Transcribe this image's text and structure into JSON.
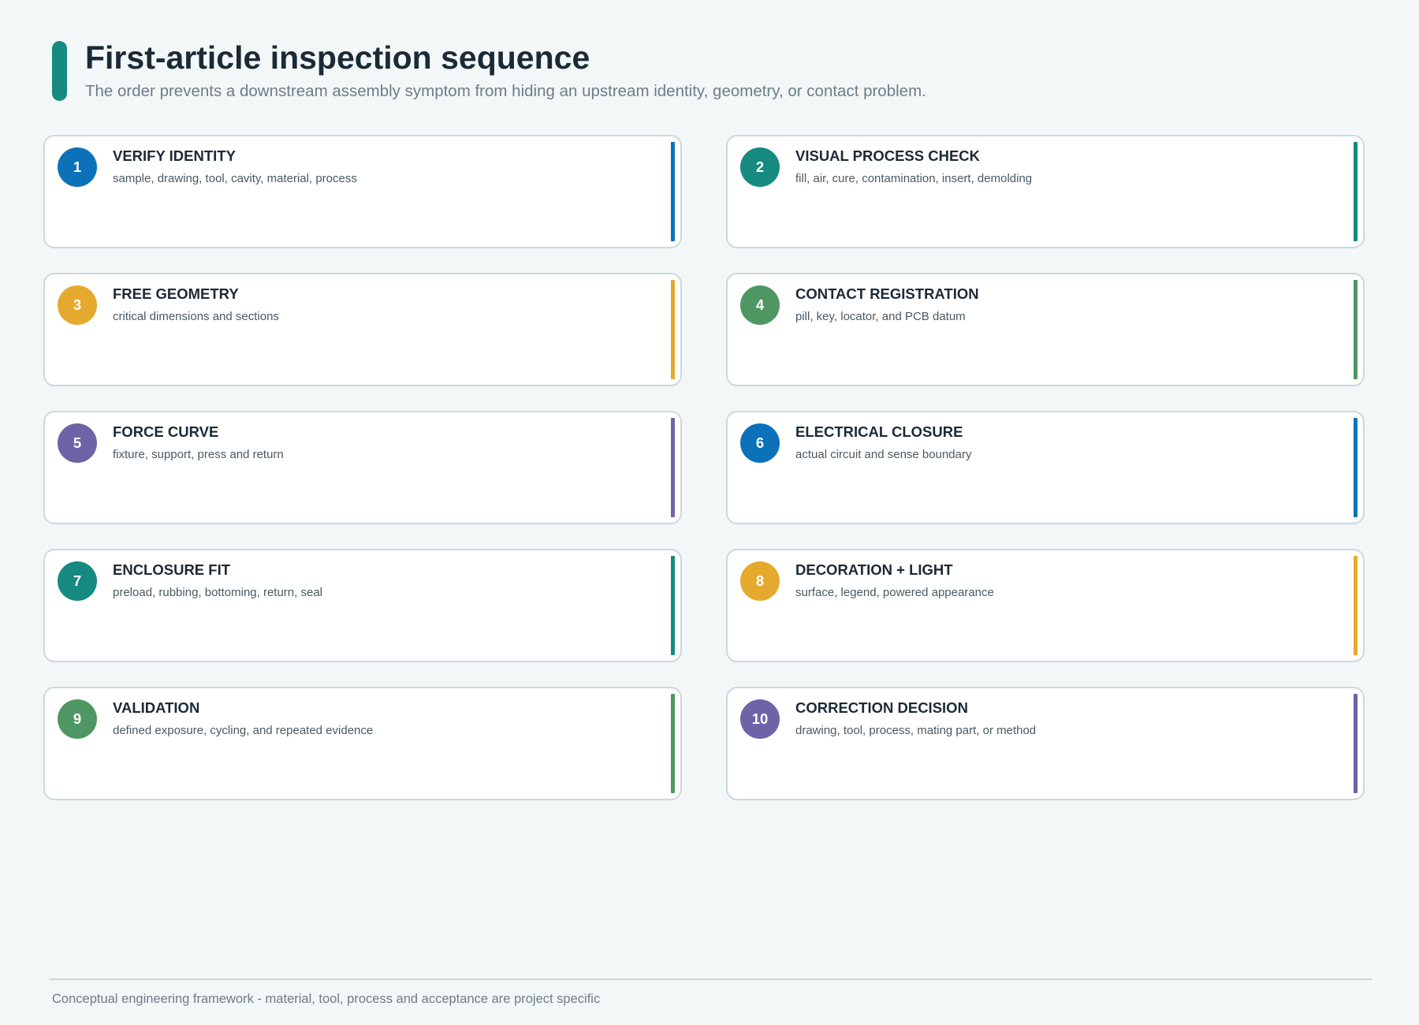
{
  "header": {
    "title": "First-article inspection sequence",
    "subtitle": "The order prevents a downstream assembly symptom from hiding an upstream identity, geometry, or contact problem.",
    "accent_color": "#168a80"
  },
  "steps": [
    {
      "number": "1",
      "title": "VERIFY IDENTITY",
      "description": "sample, drawing, tool, cavity, material, process",
      "color": "#0b72b9"
    },
    {
      "number": "2",
      "title": "VISUAL PROCESS CHECK",
      "description": "fill, air, cure, contamination, insert, demolding",
      "color": "#168a80"
    },
    {
      "number": "3",
      "title": "FREE GEOMETRY",
      "description": "critical dimensions and sections",
      "color": "#e5aa2d"
    },
    {
      "number": "4",
      "title": "CONTACT REGISTRATION",
      "description": "pill, key, locator, and PCB datum",
      "color": "#4f9762"
    },
    {
      "number": "5",
      "title": "FORCE CURVE",
      "description": "fixture, support, press and return",
      "color": "#6f63a8"
    },
    {
      "number": "6",
      "title": "ELECTRICAL CLOSURE",
      "description": "actual circuit and sense boundary",
      "color": "#0b72b9"
    },
    {
      "number": "7",
      "title": "ENCLOSURE FIT",
      "description": "preload, rubbing, bottoming, return, seal",
      "color": "#168a80"
    },
    {
      "number": "8",
      "title": "DECORATION + LIGHT",
      "description": "surface, legend, powered appearance",
      "color": "#e5aa2d"
    },
    {
      "number": "9",
      "title": "VALIDATION",
      "description": "defined exposure, cycling, and repeated evidence",
      "color": "#4f9762"
    },
    {
      "number": "10",
      "title": "CORRECTION DECISION",
      "description": "drawing, tool, process, mating part, or method",
      "color": "#6f63a8"
    }
  ],
  "footer": {
    "note": "Conceptual engineering framework - material, tool, process and acceptance are project specific"
  }
}
